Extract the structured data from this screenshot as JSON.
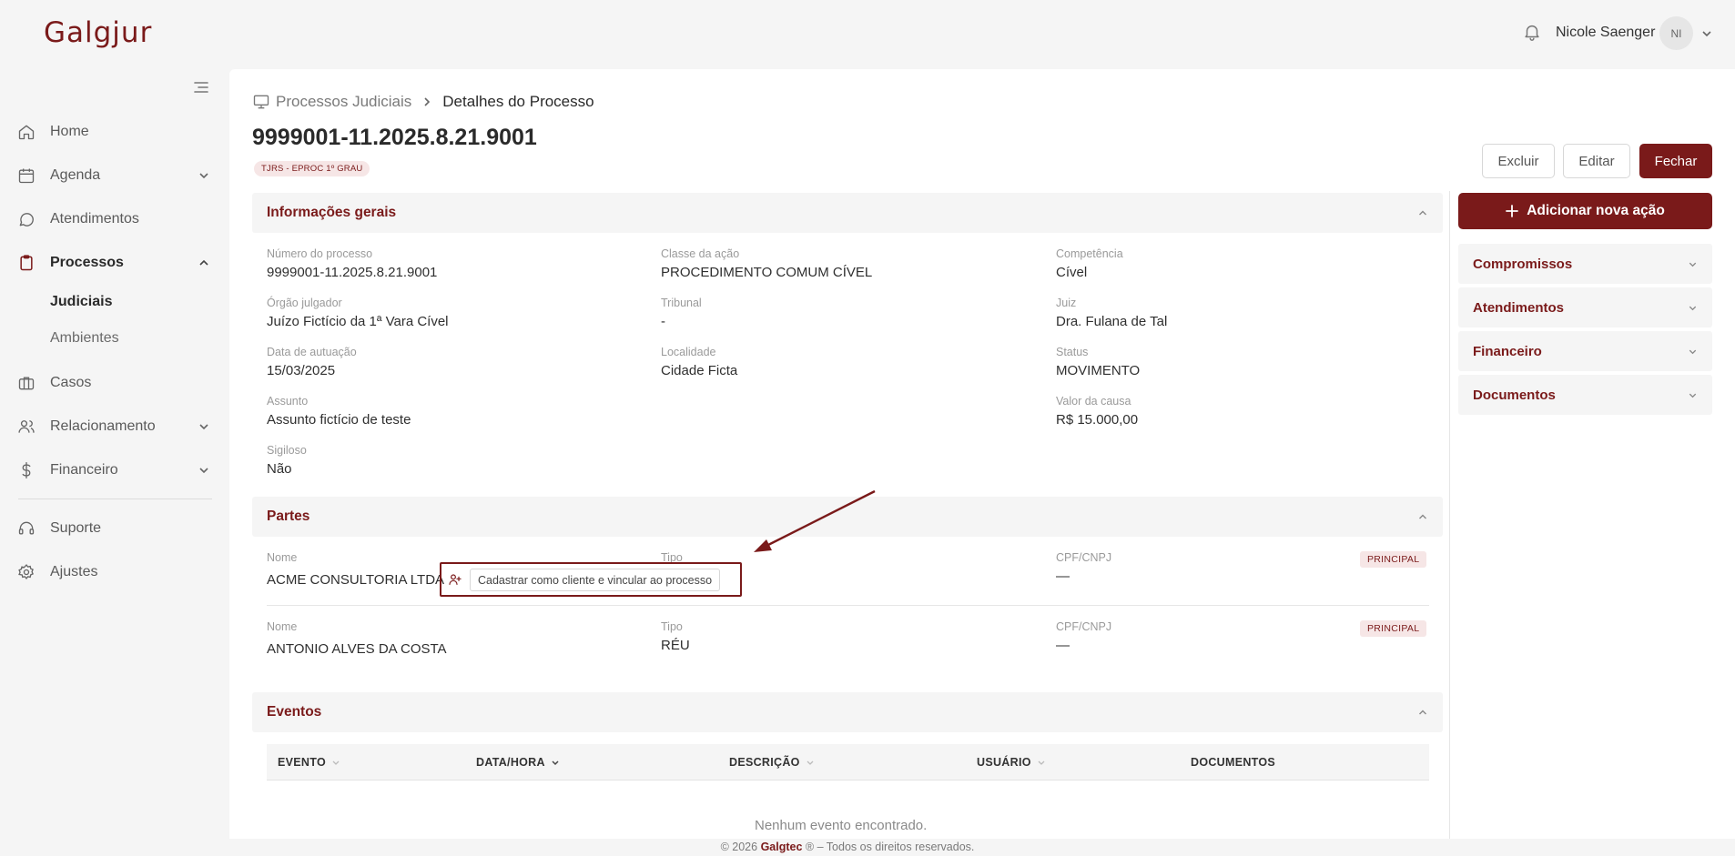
{
  "app": {
    "logo": "Galgjur"
  },
  "user": {
    "name": "Nicole Saenger",
    "initials": "NI"
  },
  "sidebar": {
    "items": [
      {
        "label": "Home",
        "icon": "home-icon"
      },
      {
        "label": "Agenda",
        "icon": "calendar-icon"
      },
      {
        "label": "Atendimentos",
        "icon": "chat-icon"
      },
      {
        "label": "Processos",
        "icon": "clipboard-icon"
      },
      {
        "label": "Casos",
        "icon": "briefcase-icon"
      },
      {
        "label": "Relacionamento",
        "icon": "users-icon"
      },
      {
        "label": "Financeiro",
        "icon": "dollar-icon"
      },
      {
        "label": "Suporte",
        "icon": "headset-icon"
      },
      {
        "label": "Ajustes",
        "icon": "gear-icon"
      }
    ],
    "sub_items": [
      {
        "label": "Judiciais"
      },
      {
        "label": "Ambientes"
      }
    ]
  },
  "breadcrumb": {
    "parent": "Processos Judiciais",
    "current": "Detalhes do Processo"
  },
  "process": {
    "number": "9999001-11.2025.8.21.9001",
    "court_badge": "TJRS - EPROC 1º GRAU"
  },
  "actions": {
    "delete": "Excluir",
    "edit": "Editar",
    "close": "Fechar"
  },
  "general": {
    "title": "Informações gerais",
    "fields": {
      "numero": {
        "label": "Número do processo",
        "value": "9999001-11.2025.8.21.9001"
      },
      "classe": {
        "label": "Classe da ação",
        "value": "PROCEDIMENTO COMUM CÍVEL"
      },
      "competencia": {
        "label": "Competência",
        "value": "Cível"
      },
      "orgao": {
        "label": "Órgão julgador",
        "value": "Juízo Fictício da 1ª Vara Cível"
      },
      "tribunal": {
        "label": "Tribunal",
        "value": "-"
      },
      "juiz": {
        "label": "Juiz",
        "value": "Dra. Fulana de Tal"
      },
      "data": {
        "label": "Data de autuação",
        "value": "15/03/2025"
      },
      "localidade": {
        "label": "Localidade",
        "value": "Cidade Ficta"
      },
      "status": {
        "label": "Status",
        "value": "MOVIMENTO"
      },
      "assunto": {
        "label": "Assunto",
        "value": "Assunto fictício de teste"
      },
      "valor": {
        "label": "Valor da causa",
        "value": "R$ 15.000,00"
      },
      "sigiloso": {
        "label": "Sigiloso",
        "value": "Não"
      }
    }
  },
  "parties": {
    "title": "Partes",
    "rows": [
      {
        "name_label": "Nome",
        "name": "ACME CONSULTORIA LTDA",
        "type_label": "Tipo",
        "type": "",
        "doc_label": "CPF/CNPJ",
        "doc": "—",
        "badge": "PRINCIPAL"
      },
      {
        "name_label": "Nome",
        "name": "ANTONIO ALVES DA COSTA",
        "type_label": "Tipo",
        "type": "RÉU",
        "doc_label": "CPF/CNPJ",
        "doc": "—",
        "badge": "PRINCIPAL"
      }
    ],
    "register_button": "Cadastrar como cliente e vincular ao processo"
  },
  "events": {
    "title": "Eventos",
    "columns": [
      "EVENTO",
      "DATA/HORA",
      "DESCRIÇÃO",
      "USUÁRIO",
      "DOCUMENTOS"
    ],
    "empty": "Nenhum evento encontrado."
  },
  "right_panel": {
    "add_action": "Adicionar nova ação",
    "sections": [
      "Compromissos",
      "Atendimentos",
      "Financeiro",
      "Documentos"
    ]
  },
  "footer": {
    "prefix": "© 2026",
    "brand": "Galgtec",
    "suffix": "® – Todos os direitos reservados."
  },
  "colors": {
    "accent": "#7a1a1a",
    "badge_bg": "#f6e6e6",
    "page_bg": "#f5f5f5"
  }
}
